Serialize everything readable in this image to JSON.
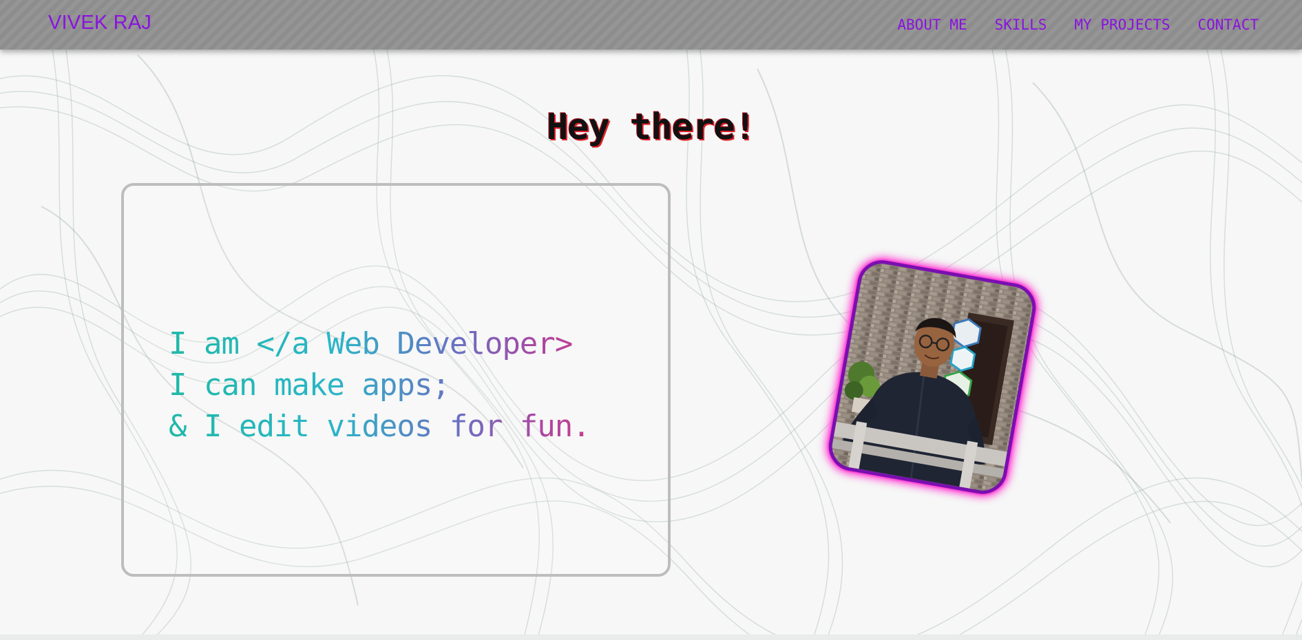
{
  "navbar": {
    "brand": "VIVEK RAJ",
    "links": [
      {
        "label": "ABOUT ME"
      },
      {
        "label": "SKILLS"
      },
      {
        "label": "MY PROJECTS"
      },
      {
        "label": "CONTACT"
      }
    ]
  },
  "hero": {
    "heading": "Hey there!",
    "intro_lines": [
      "I am </a Web Developer>",
      "I can make apps;",
      "& I edit videos for fun."
    ],
    "photo_icon": "profile-photo"
  },
  "colors": {
    "brand": "#8a12e0",
    "navbar_bg": "#8d8d8d",
    "gradient_start": "#1fb8a8",
    "gradient_end": "#d83a7c",
    "photo_border": "#7a0fb0",
    "photo_glow": "#ff2bd0"
  }
}
